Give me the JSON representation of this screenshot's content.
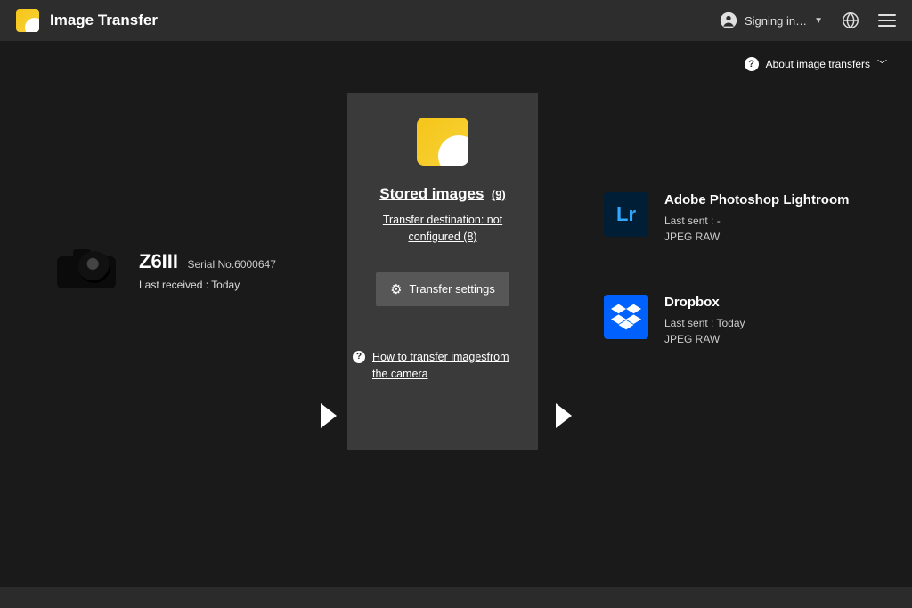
{
  "header": {
    "title": "Image Transfer",
    "user_status": "Signing in…"
  },
  "infobar": {
    "about_label": "About image transfers"
  },
  "camera": {
    "model": "Z6III",
    "serial_label": "Serial No.6000647",
    "last_received_label": "Last received :",
    "last_received_value": "Today"
  },
  "center": {
    "stored_label": "Stored images",
    "stored_count": "(9)",
    "destination_line": "Transfer destination: not configured  (8)",
    "transfer_btn": "Transfer settings",
    "howto_label": "How to transfer imagesfrom the camera"
  },
  "services": [
    {
      "name": "Adobe Photoshop Lightroom",
      "last_sent_label": "Last sent :",
      "last_sent_value": "-",
      "formats": "JPEG RAW",
      "icon": "lr"
    },
    {
      "name": "Dropbox",
      "last_sent_label": "Last sent :",
      "last_sent_value": "Today",
      "formats": "JPEG RAW",
      "icon": "db"
    }
  ]
}
